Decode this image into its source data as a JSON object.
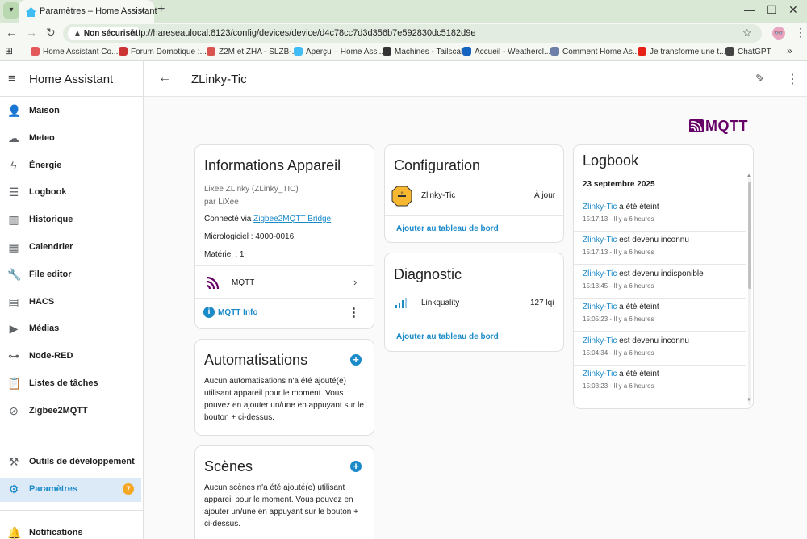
{
  "browser": {
    "tab_title": "Paramètres – Home Assistant",
    "security_label": "Non sécurisé",
    "url": "http://hareseaulocal:8123/config/devices/device/d4c78cc7d3d356b7e592830dc5182d9e",
    "bookmarks": [
      {
        "label": "Home Assistant Co...",
        "color": "#e35a5a"
      },
      {
        "label": "Forum Domotique :...",
        "color": "#cc3333"
      },
      {
        "label": "Z2M et ZHA - SLZB-...",
        "color": "#d9534f"
      },
      {
        "label": "Aperçu – Home Assi...",
        "color": "#41bdf5"
      },
      {
        "label": "Machines - Tailscale",
        "color": "#333333"
      },
      {
        "label": "Accueil - Weathercl...",
        "color": "#1565c0"
      },
      {
        "label": "Comment Home As...",
        "color": "#6b7fa8"
      },
      {
        "label": "Je transforme une t...",
        "color": "#e62117"
      },
      {
        "label": "ChatGPT",
        "color": "#444444"
      }
    ]
  },
  "sidebar": {
    "title": "Home Assistant",
    "items": [
      {
        "label": "Maison",
        "icon": "person-icon"
      },
      {
        "label": "Meteo",
        "icon": "weather-icon"
      },
      {
        "label": "Énergie",
        "icon": "lightning-icon"
      },
      {
        "label": "Logbook",
        "icon": "list-icon"
      },
      {
        "label": "Historique",
        "icon": "chart-icon"
      },
      {
        "label": "Calendrier",
        "icon": "calendar-icon"
      },
      {
        "label": "File editor",
        "icon": "wrench-icon"
      },
      {
        "label": "HACS",
        "icon": "hacs-icon"
      },
      {
        "label": "Médias",
        "icon": "media-icon"
      },
      {
        "label": "Node-RED",
        "icon": "sitemap-icon"
      },
      {
        "label": "Listes de tâches",
        "icon": "clipboard-icon"
      },
      {
        "label": "Zigbee2MQTT",
        "icon": "zigbee-icon"
      }
    ],
    "dev_tools": "Outils de développement",
    "settings": "Paramètres",
    "settings_badge": "7",
    "notifications": "Notifications"
  },
  "header": {
    "title": "ZLinky-Tic"
  },
  "logo_text": "MQTT",
  "device_info": {
    "title": "Informations Appareil",
    "model": "Lixee ZLinky (ZLinky_TIC)",
    "manufacturer": "par LiXee",
    "connected_prefix": "Connecté via ",
    "connected_link": "Zigbee2MQTT Bridge",
    "firmware": "Micrologiciel : 4000-0016",
    "hardware": "Matériel : 1",
    "integration": "MQTT",
    "info_link": "MQTT Info"
  },
  "automations": {
    "title": "Automatisations",
    "text": [
      "Aucun automatisations n'a été ajouté(e)",
      "utilisant appareil pour le moment. Vous",
      "pouvez en ajouter un/une en appuyant sur le",
      "bouton + ci-dessus."
    ]
  },
  "scenes": {
    "title": "Scènes",
    "text": [
      "Aucun scènes n'a été ajouté(e) utilisant",
      "appareil pour le moment. Vous pouvez en",
      "ajouter un/une en appuyant sur le bouton +",
      "ci-dessus."
    ]
  },
  "configuration": {
    "title": "Configuration",
    "entity_name": "Zlinky-Tic",
    "entity_state": "À jour",
    "add_link": "Ajouter au tableau de bord"
  },
  "diagnostic": {
    "title": "Diagnostic",
    "entity_name": "Linkquality",
    "entity_value": "127 lqi",
    "add_link": "Ajouter au tableau de bord"
  },
  "logbook": {
    "title": "Logbook",
    "date": "23 septembre 2025",
    "entries": [
      {
        "entity": "Zlinky-Tic",
        "message": " a été éteint",
        "time": "15:17:13 - Il y a 6 heures"
      },
      {
        "entity": "Zlinky-Tic",
        "message": " est devenu inconnu",
        "time": "15:17:13 - Il y a 6 heures"
      },
      {
        "entity": "Zlinky-Tic",
        "message": " est devenu indisponible",
        "time": "15:13:45 - Il y a 6 heures"
      },
      {
        "entity": "Zlinky-Tic",
        "message": " a été éteint",
        "time": "15:05:23 - Il y a 6 heures"
      },
      {
        "entity": "Zlinky-Tic",
        "message": " est devenu inconnu",
        "time": "15:04:34 - Il y a 6 heures"
      },
      {
        "entity": "Zlinky-Tic",
        "message": " a été éteint",
        "time": "15:03:23 - Il y a 6 heures"
      }
    ]
  },
  "colors": {
    "accent": "#1b8ac9",
    "mqtt": "#660066",
    "badge": "#f5a623"
  }
}
